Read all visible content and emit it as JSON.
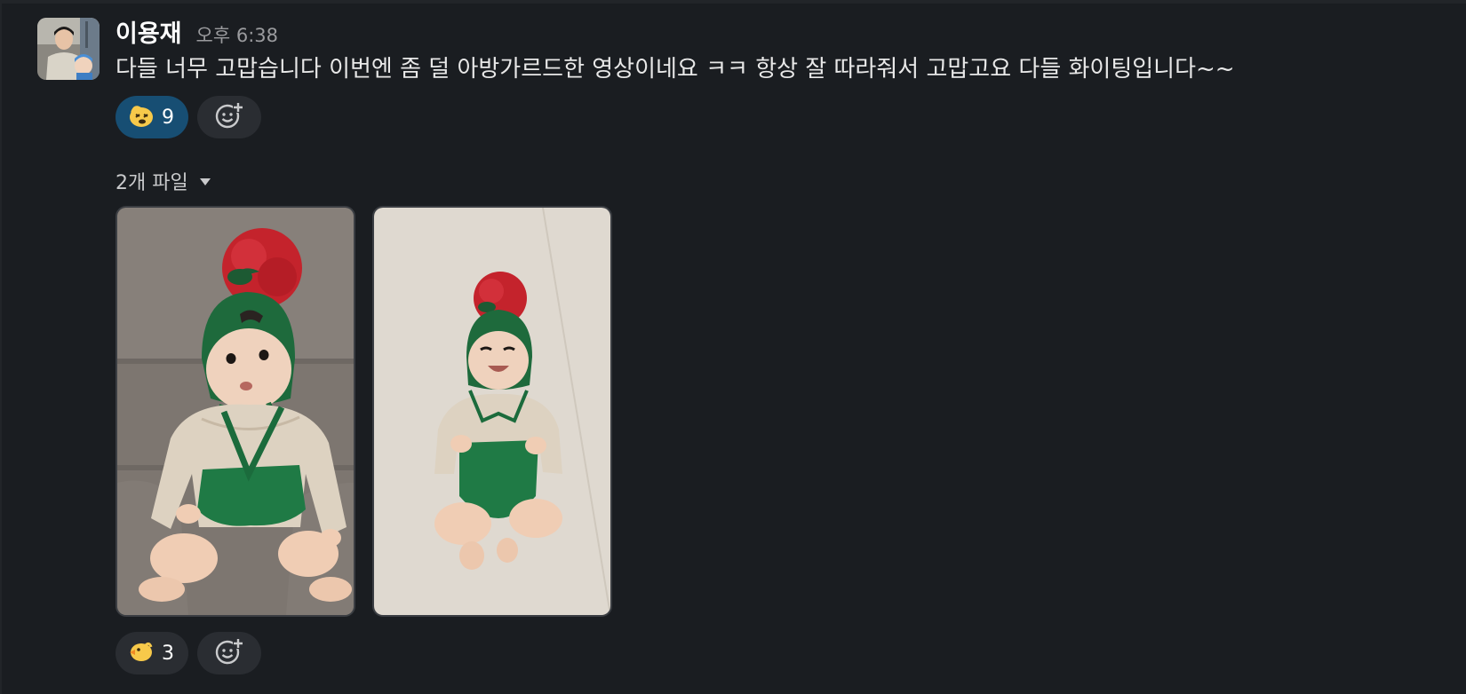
{
  "message": {
    "author": "이용재",
    "time": "오후 6:38",
    "text": "다들 너무 고맙습니다 이번엔 좀 덜 아방가르드한 영상이네요 ㅋㅋ 항상 잘 따라줘서 고맙고요 다들 화이팅입니다~~",
    "avatar_icon": "user-avatar"
  },
  "reactions_top": [
    {
      "emoji_icon": "dizzy-face-emoji-icon",
      "count": "9",
      "active": true
    }
  ],
  "files": {
    "label": "2개 파일",
    "toggle_icon": "caret-down-icon",
    "images": [
      {
        "name": "baby-sitting-photo"
      },
      {
        "name": "baby-lying-photo"
      }
    ]
  },
  "reactions_bottom": [
    {
      "emoji_icon": "chick-emoji-icon",
      "count": "3",
      "active": false
    }
  ],
  "colors": {
    "background": "#1a1d21",
    "active_reaction": "#174e73",
    "reaction": "#2a2d32"
  }
}
